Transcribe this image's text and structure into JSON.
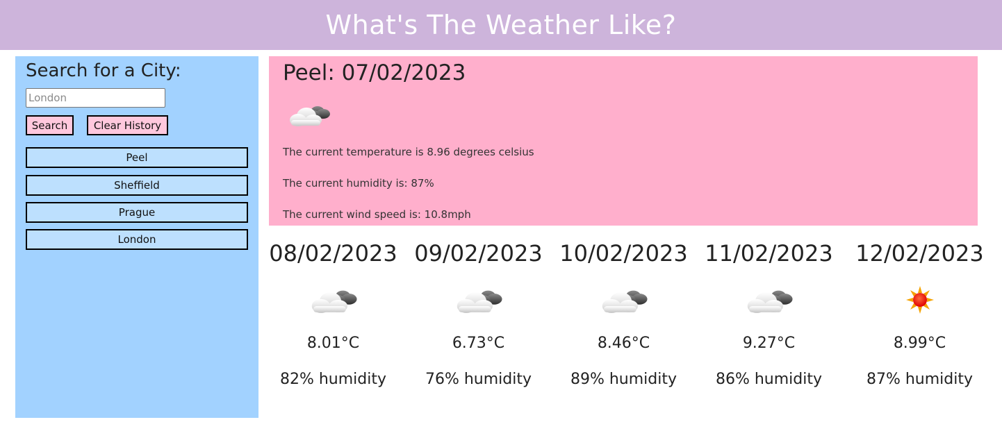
{
  "header": {
    "title": "What's The Weather Like?"
  },
  "sidebar": {
    "heading": "Search for a City:",
    "search": {
      "value": "",
      "placeholder": "London"
    },
    "search_label": "Search",
    "clear_label": "Clear History",
    "history": [
      "Peel",
      "Sheffield",
      "Prague",
      "London"
    ]
  },
  "current": {
    "heading": "Peel: 07/02/2023",
    "icon": "clouds-icon",
    "temperature_text": "The current temperature is 8.96 degrees celsius",
    "humidity_text": "The current humidity is: 87%",
    "wind_text": "The current wind speed is: 10.8mph"
  },
  "forecast": [
    {
      "date": "08/02/2023",
      "icon": "clouds-icon",
      "temp": "8.01°C",
      "humidity": "82% humidity"
    },
    {
      "date": "09/02/2023",
      "icon": "clouds-icon",
      "temp": "6.73°C",
      "humidity": "76% humidity"
    },
    {
      "date": "10/02/2023",
      "icon": "clouds-icon",
      "temp": "8.46°C",
      "humidity": "89% humidity"
    },
    {
      "date": "11/02/2023",
      "icon": "clouds-icon",
      "temp": "9.27°C",
      "humidity": "86% humidity"
    },
    {
      "date": "12/02/2023",
      "icon": "sun-icon",
      "temp": "8.99°C",
      "humidity": "87% humidity"
    }
  ],
  "colors": {
    "header": "#cdb4db",
    "sidebar": "#a2d2ff",
    "current_panel": "#ffafcc",
    "button": "#ffc8dd",
    "history_button": "#bde0fe"
  }
}
